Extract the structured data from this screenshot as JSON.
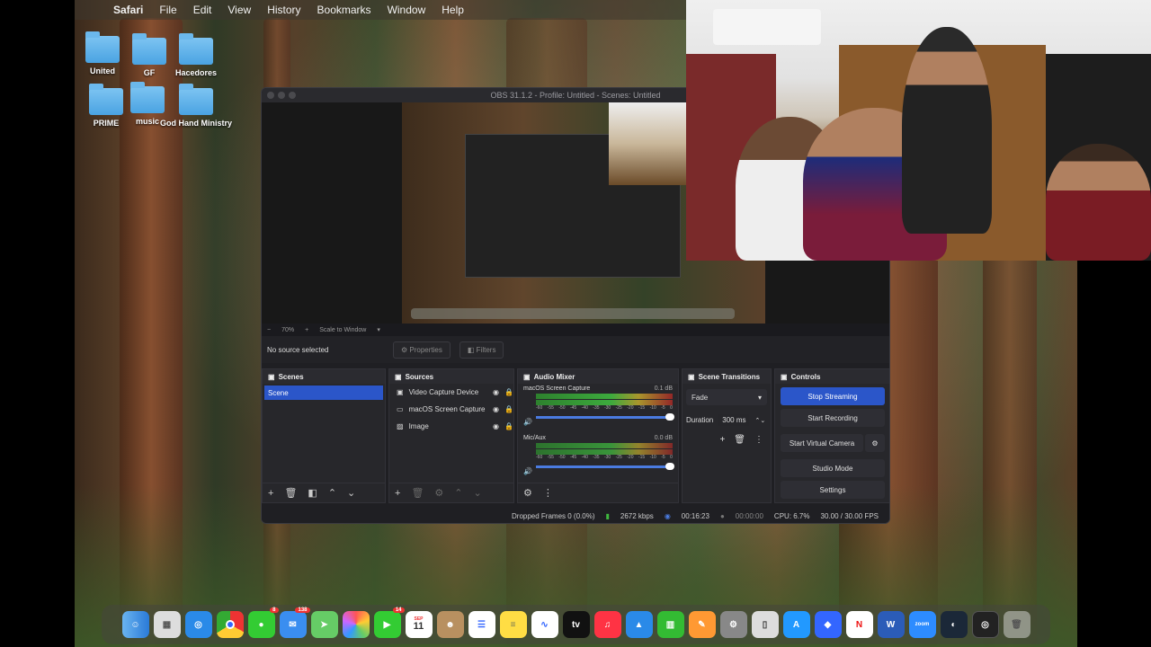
{
  "menubar": {
    "app": "Safari",
    "items": [
      "File",
      "Edit",
      "View",
      "History",
      "Bookmarks",
      "Window",
      "Help"
    ]
  },
  "desktop_icons": [
    "United",
    "GF",
    "Hacedores",
    "PRIME",
    "music",
    "God Hand Ministry"
  ],
  "obs": {
    "title": "OBS 31.1.2 - Profile: Untitled - Scenes: Untitled",
    "zoom": "70%",
    "scale_mode": "Scale to Window",
    "no_source": "No source selected",
    "properties_label": "Properties",
    "filters_label": "Filters",
    "scenes": {
      "header": "Scenes",
      "items": [
        "Scene"
      ]
    },
    "sources": {
      "header": "Sources",
      "items": [
        "Video Capture Device",
        "macOS Screen Capture",
        "Image"
      ]
    },
    "audio_mixer": {
      "header": "Audio Mixer",
      "tracks": [
        {
          "name": "macOS Screen Capture",
          "db": "0.1 dB"
        },
        {
          "name": "Mic/Aux",
          "db": "0.0 dB"
        }
      ],
      "scale": [
        "-60",
        "-55",
        "-50",
        "-45",
        "-40",
        "-35",
        "-30",
        "-25",
        "-20",
        "-15",
        "-10",
        "-5",
        "0"
      ]
    },
    "scene_transitions": {
      "header": "Scene Transitions",
      "transition": "Fade",
      "duration_label": "Duration",
      "duration_value": "300 ms"
    },
    "controls": {
      "header": "Controls",
      "stop_streaming": "Stop Streaming",
      "start_recording": "Start Recording",
      "start_virtual_camera": "Start Virtual Camera",
      "studio_mode": "Studio Mode",
      "settings": "Settings"
    },
    "status": {
      "dropped_frames": "Dropped Frames 0 (0.0%)",
      "bitrate": "2672 kbps",
      "stream_time": "00:16:23",
      "record_time": "00:00:00",
      "cpu": "CPU: 6.7%",
      "fps": "30.00 / 30.00 FPS"
    }
  },
  "dock": {
    "apps": [
      "Finder",
      "Launchpad",
      "Safari",
      "Chrome",
      "Messages",
      "Mail",
      "Maps",
      "Photos",
      "FaceTime",
      "Calendar",
      "Contacts",
      "Reminders",
      "Notes",
      "Freeform",
      "TV",
      "Music",
      "Keynote",
      "Numbers",
      "Pages",
      "System Settings",
      "iPhone Mirroring",
      "App Store",
      "Preview",
      "Netflix",
      "Word",
      "Zoom",
      "Steam",
      "OBS",
      "Trash"
    ],
    "calendar_month": "SEP",
    "calendar_day": "11",
    "badge_messages": "8",
    "badge_mail": "138",
    "badge_facetime": "14"
  }
}
